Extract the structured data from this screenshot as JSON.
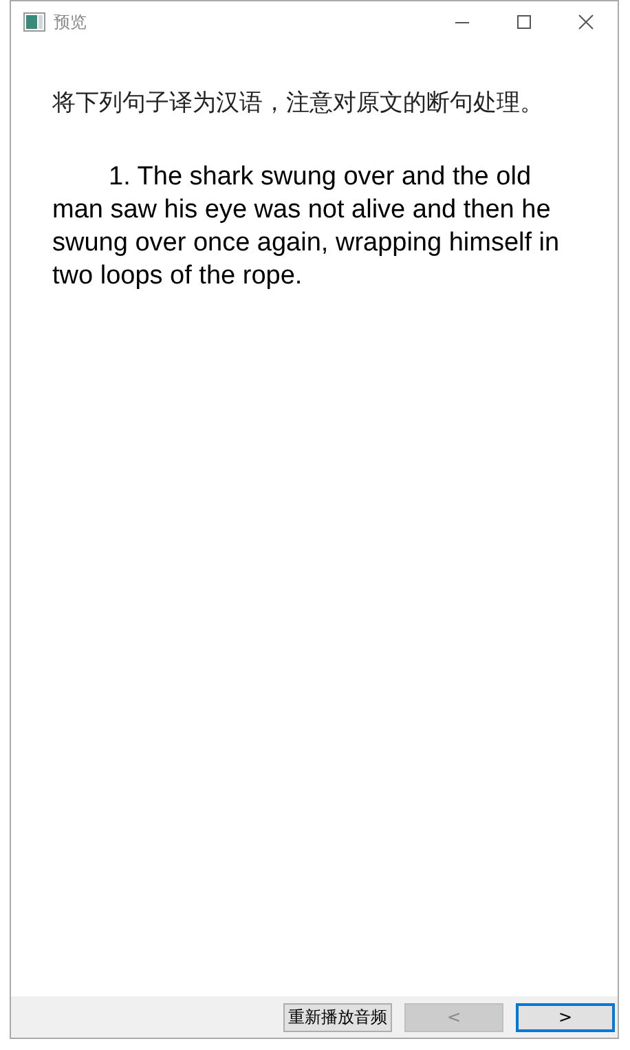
{
  "window": {
    "title": "预览"
  },
  "instruction": "将下列句子译为汉语，注意对原文的断句处理。",
  "sentence": "1. The shark swung over and the old man saw his eye was not alive and then he swung over once again, wrapping himself in two loops of the rope.",
  "buttons": [
    {
      "kind": "text",
      "label": "重新播放音频",
      "disabled": false,
      "focused": false
    },
    {
      "kind": "nav",
      "label": "<",
      "disabled": true,
      "focused": false
    },
    {
      "kind": "nav",
      "label": ">",
      "disabled": false,
      "focused": true
    }
  ]
}
